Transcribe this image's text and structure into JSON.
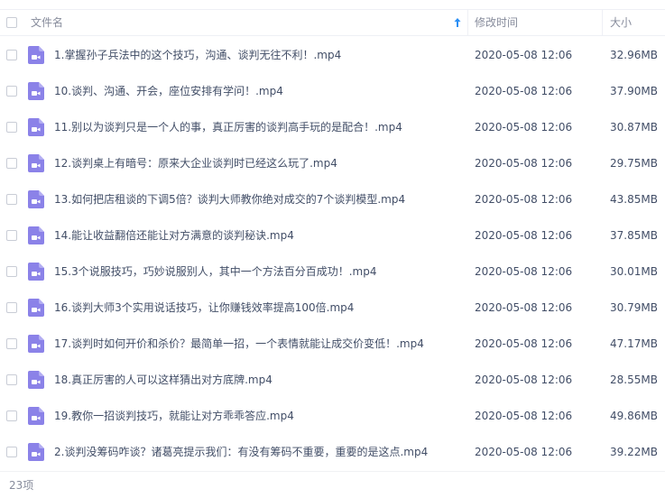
{
  "header": {
    "name_col": "文件名",
    "date_col": "修改时间",
    "size_col": "大小"
  },
  "sort": {
    "icon": "sort-up-arrow-icon",
    "color": "#2b8ff5"
  },
  "file_icon": {
    "name": "video-file-icon",
    "color": "#8b82e8"
  },
  "files": [
    {
      "name": "1.掌握孙子兵法中的这个技巧，沟通、谈判无往不利！.mp4",
      "modified": "2020-05-08 12:06",
      "size": "32.96MB"
    },
    {
      "name": "10.谈判、沟通、开会，座位安排有学问！.mp4",
      "modified": "2020-05-08 12:06",
      "size": "37.90MB"
    },
    {
      "name": "11.别以为谈判只是一个人的事，真正厉害的谈判高手玩的是配合！.mp4",
      "modified": "2020-05-08 12:06",
      "size": "30.87MB"
    },
    {
      "name": "12.谈判桌上有暗号：原来大企业谈判时已经这么玩了.mp4",
      "modified": "2020-05-08 12:06",
      "size": "29.75MB"
    },
    {
      "name": "13.如何把店租谈的下调5倍？谈判大师教你绝对成交的7个谈判模型.mp4",
      "modified": "2020-05-08 12:06",
      "size": "43.85MB"
    },
    {
      "name": "14.能让收益翻倍还能让对方满意的谈判秘诀.mp4",
      "modified": "2020-05-08 12:06",
      "size": "37.85MB"
    },
    {
      "name": "15.3个说服技巧，巧妙说服别人，其中一个方法百分百成功！.mp4",
      "modified": "2020-05-08 12:06",
      "size": "30.01MB"
    },
    {
      "name": "16.谈判大师3个实用说话技巧，让你赚钱效率提高100倍.mp4",
      "modified": "2020-05-08 12:06",
      "size": "30.79MB"
    },
    {
      "name": "17.谈判时如何开价和杀价？最简单一招，一个表情就能让成交价变低！.mp4",
      "modified": "2020-05-08 12:06",
      "size": "47.17MB"
    },
    {
      "name": "18.真正厉害的人可以这样猜出对方底牌.mp4",
      "modified": "2020-05-08 12:06",
      "size": "28.55MB"
    },
    {
      "name": "19.教你一招谈判技巧，就能让对方乖乖答应.mp4",
      "modified": "2020-05-08 12:06",
      "size": "49.86MB"
    },
    {
      "name": "2.谈判没筹码咋谈？诸葛亮提示我们：有没有筹码不重要，重要的是这点.mp4",
      "modified": "2020-05-08 12:06",
      "size": "39.22MB"
    }
  ],
  "footer": {
    "count": "23项"
  }
}
